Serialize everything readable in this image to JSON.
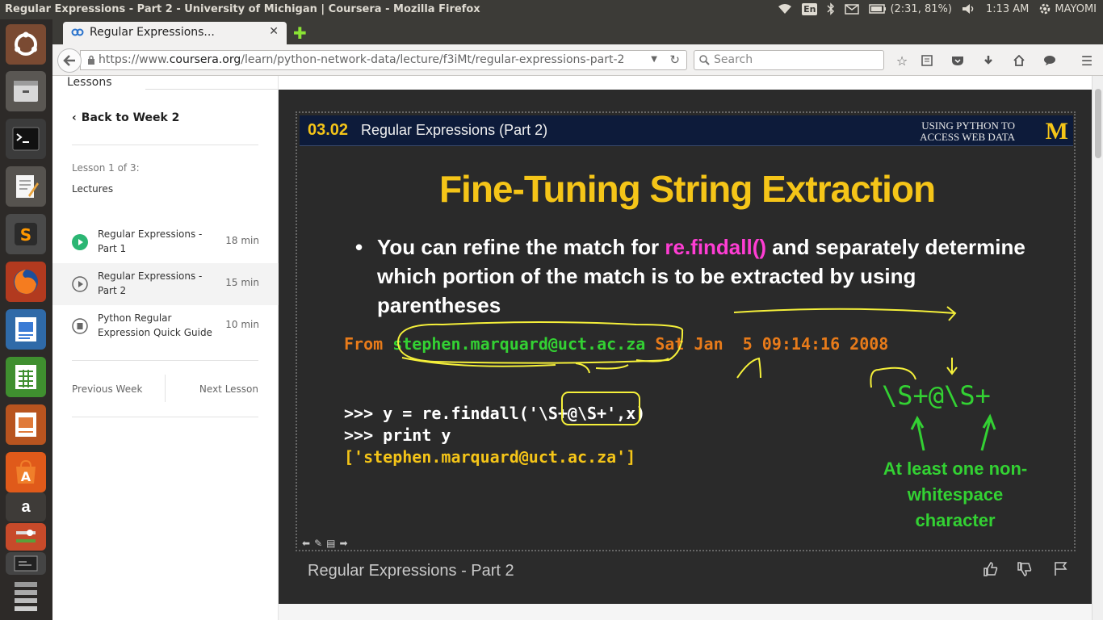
{
  "system": {
    "window_title": "Regular Expressions - Part 2 - University of Michigan | Coursera - Mozilla Firefox",
    "keyboard_layout": "En",
    "battery": "(2:31, 81%)",
    "clock": "1:13 AM",
    "user": "MAYOMI"
  },
  "launcher": {
    "items": [
      "ubuntu-dash",
      "files",
      "terminal",
      "text-editor",
      "sublime-text",
      "firefox",
      "libreoffice-impress",
      "libreoffice-calc",
      "libreoffice-impress-2",
      "software-center",
      "amazon",
      "system-settings",
      "workspace-switcher",
      "trash"
    ]
  },
  "browser": {
    "tab_title": "Regular Expressions...",
    "url_prefix": "https://www.",
    "url_domain": "coursera.org",
    "url_path": "/learn/python-network-data/lecture/f3iMt/regular-expressions-part-2",
    "search_placeholder": "Search"
  },
  "sidebar": {
    "tab_label": "Lessons",
    "back_label": "Back to Week 2",
    "lesson_of": "Lesson 1 of 3:",
    "section_label": "Lectures",
    "items": [
      {
        "title": "Regular Expressions - Part 1",
        "duration": "18 min",
        "status": "completed"
      },
      {
        "title": "Regular Expressions - Part 2",
        "duration": "15 min",
        "status": "current"
      },
      {
        "title": "Python Regular Expression Quick Guide",
        "duration": "10 min",
        "status": "reading"
      }
    ],
    "prev_label": "Previous Week",
    "next_label": "Next Lesson"
  },
  "slide": {
    "number": "03.02",
    "header_title": "Regular Expressions (Part 2)",
    "course_line1": "USING PYTHON TO",
    "course_line2": "ACCESS WEB DATA",
    "logo": "M",
    "title": "Fine-Tuning String Extraction",
    "bullet_part1": "You can refine the match for ",
    "bullet_highlight": "re.findall()",
    "bullet_part2": " and separately determine which portion of the match is to be extracted by using parentheses",
    "from_prefix": "From ",
    "from_email": "stephen.marquard@uct.ac.za",
    "from_suffix": " Sat Jan  5 09:14:16 2008",
    "code_line1": ">>> y = re.findall('\\S+@\\S+',x)",
    "code_line2": ">>> print y",
    "code_line3": "['stephen.marquard@uct.ac.za']",
    "regex": "\\S+@\\S+",
    "note": "At least one non-whitespace character"
  },
  "video": {
    "title": "Regular Expressions - Part 2"
  },
  "colors": {
    "accent_green": "#33d133",
    "slide_yellow": "#f5c518",
    "highlight_pink": "#ff3dd4",
    "code_orange": "#e87b1a"
  }
}
